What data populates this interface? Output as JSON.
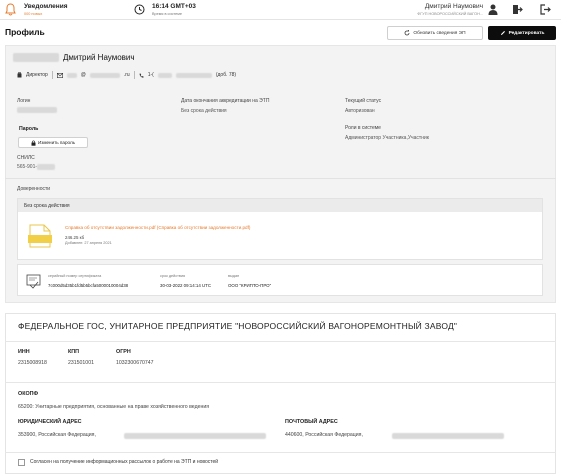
{
  "topbar": {
    "notifications_title": "Уведомления",
    "notifications_sub": "000 новых",
    "time": "16:14 GMT+03",
    "time_sub": "Время в системе",
    "user_name": "Дмитрий Наумович",
    "user_org": "ФГУП НОВОРОССИЙСКИЙ ВАГОН..."
  },
  "header": {
    "title": "Профиль",
    "update_button": "Обновить сведения ЭП",
    "edit_button": "Редактировать"
  },
  "profile": {
    "full_name": "Дмитрий Наумович",
    "role": "Директор",
    "email_suffix": "@",
    "email_domain": ".ru",
    "phone_prefix": "1-(",
    "phone_ext": "(доб. 78)",
    "login_label": "Логин",
    "accreditation_label": "Дата окончания аккредитации на ЭТП",
    "accreditation_value": "Без срока действия",
    "status_label": "Текущий статус",
    "status_value": "Авторизован",
    "password_label": "Пароль",
    "change_password_button": "Изменить пароль",
    "roles_label": "Роли в системе",
    "roles_value": "Администратор Участника,Участник",
    "snils_label": "СНИЛС",
    "snils_value": "565-901-"
  },
  "trust": {
    "section_label": "Доверенности",
    "validity": "Без срока действия",
    "doc_link": "Справка об отсутствии задолженности.pdf (Справка об отсутствии задолженности.pdf)",
    "doc_size": "246.25 кб",
    "doc_date": "Добавлен: 27 апреля 2021"
  },
  "certificate": {
    "serial_label": "серийный номер сертификата",
    "serial_value": "7c000d5d35b1fd5b5bcfa5000010004d38",
    "validity_label": "срок действия",
    "validity_value": "30-03-2022 09:14:14 UTC",
    "issuer_label": "выдан",
    "issuer_value": "ООО \"КРИПТО-ПРО\""
  },
  "organization": {
    "title": "ФЕДЕРАЛЬНОЕ ГОС, УНИТАРНОЕ ПРЕДПРИЯТИЕ \"НОВОРОССИЙСКИЙ ВАГОНОРЕМОНТНЫЙ ЗАВОД\"",
    "inn_label": "ИНН",
    "inn_value": "2315008918",
    "kpp_label": "КПП",
    "kpp_value": "231501001",
    "ogrn_label": "ОГРН",
    "ogrn_value": "1032300670747",
    "okopf_label": "ОКОПФ",
    "okopf_value": "65200: Унитарные предприятия, основанные на праве хозяйственного ведения",
    "legal_address_label": "ЮРИДИЧЕСКИЙ АДРЕС",
    "legal_address_value": "353900, Российская Федерация,",
    "postal_address_label": "ПОЧТОВЫЙ АДРЕС",
    "postal_address_value": "440600, Российская Федерация,",
    "consent_text": "Согласен на получение информационных рассылок о работе на ЭТП и новостей"
  },
  "colors": {
    "accent": "#e7792b",
    "panel": "#f3f3f3",
    "primary_button": "#0d0d0d"
  }
}
